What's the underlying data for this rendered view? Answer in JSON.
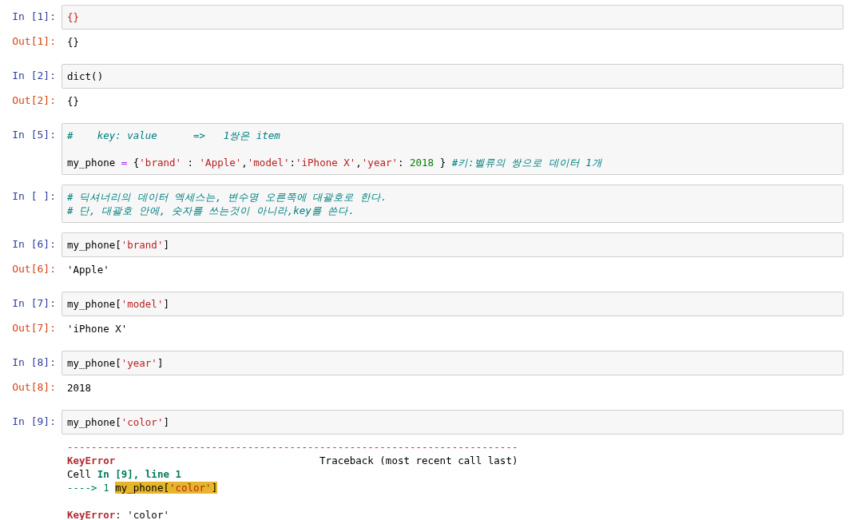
{
  "cells": [
    {
      "prompt": "In [1]:",
      "code": [
        {
          "tokens": [
            {
              "kind": "str",
              "text": "{}"
            }
          ]
        }
      ],
      "out_prompt": "Out[1]:",
      "output": [
        {
          "tokens": [
            {
              "kind": "plain",
              "text": "{}"
            }
          ]
        }
      ]
    },
    {
      "prompt": "In [2]:",
      "code": [
        {
          "tokens": [
            {
              "kind": "plain",
              "text": "dict()"
            }
          ]
        }
      ],
      "out_prompt": "Out[2]:",
      "output": [
        {
          "tokens": [
            {
              "kind": "plain",
              "text": "{}"
            }
          ]
        }
      ]
    },
    {
      "prompt": "In [5]:",
      "code": [
        {
          "tokens": [
            {
              "kind": "comment",
              "text": "#    key: value      =>   1쌍은 item"
            }
          ]
        },
        {
          "blank_before": true,
          "tokens": [
            {
              "kind": "plain",
              "text": "my_phone "
            },
            {
              "kind": "op",
              "text": "="
            },
            {
              "kind": "plain",
              "text": " {"
            },
            {
              "kind": "str",
              "text": "'brand'"
            },
            {
              "kind": "plain",
              "text": " : "
            },
            {
              "kind": "str",
              "text": "'Apple'"
            },
            {
              "kind": "plain",
              "text": ","
            },
            {
              "kind": "str",
              "text": "'model'"
            },
            {
              "kind": "plain",
              "text": ":"
            },
            {
              "kind": "str",
              "text": "'iPhone X'"
            },
            {
              "kind": "plain",
              "text": ","
            },
            {
              "kind": "str",
              "text": "'year'"
            },
            {
              "kind": "plain",
              "text": ": "
            },
            {
              "kind": "num",
              "text": "2018"
            },
            {
              "kind": "plain",
              "text": " } "
            },
            {
              "kind": "comment",
              "text": "#키:벨류의 쌍으로 데이터 1개"
            }
          ]
        }
      ]
    },
    {
      "prompt": "In [ ]:",
      "code": [
        {
          "tokens": [
            {
              "kind": "comment",
              "text": "# 딕셔너리의 데이터 엑세스는, 변수명 오른쪽에 대괄호로 한다."
            }
          ]
        },
        {
          "tokens": [
            {
              "kind": "comment",
              "text": "# 단, 대괄호 안에, 숫자를 쓰는것이 아니라,key를 쓴다."
            }
          ]
        }
      ]
    },
    {
      "prompt": "In [6]:",
      "code": [
        {
          "tokens": [
            {
              "kind": "plain",
              "text": "my_phone["
            },
            {
              "kind": "str",
              "text": "'brand'"
            },
            {
              "kind": "plain",
              "text": "]"
            }
          ]
        }
      ],
      "out_prompt": "Out[6]:",
      "output": [
        {
          "tokens": [
            {
              "kind": "plain",
              "text": "'Apple'"
            }
          ]
        }
      ]
    },
    {
      "prompt": "In [7]:",
      "code": [
        {
          "tokens": [
            {
              "kind": "plain",
              "text": "my_phone["
            },
            {
              "kind": "str",
              "text": "'model'"
            },
            {
              "kind": "plain",
              "text": "]"
            }
          ]
        }
      ],
      "out_prompt": "Out[7]:",
      "output": [
        {
          "tokens": [
            {
              "kind": "plain",
              "text": "'iPhone X'"
            }
          ]
        }
      ]
    },
    {
      "prompt": "In [8]:",
      "code": [
        {
          "tokens": [
            {
              "kind": "plain",
              "text": "my_phone["
            },
            {
              "kind": "str",
              "text": "'year'"
            },
            {
              "kind": "plain",
              "text": "]"
            }
          ]
        }
      ],
      "out_prompt": "Out[8]:",
      "output": [
        {
          "tokens": [
            {
              "kind": "plain",
              "text": "2018"
            }
          ]
        }
      ]
    },
    {
      "prompt": "In [9]:",
      "code": [
        {
          "tokens": [
            {
              "kind": "plain",
              "text": "my_phone["
            },
            {
              "kind": "str",
              "text": "'color'"
            },
            {
              "kind": "plain",
              "text": "]"
            }
          ]
        }
      ],
      "error": [
        {
          "tokens": [
            {
              "kind": "rule",
              "text": "---------------------------------------------------------------------------"
            }
          ]
        },
        {
          "tokens": [
            {
              "kind": "err",
              "text": "KeyError"
            },
            {
              "kind": "plain",
              "text": "                                  Traceback (most recent call last)"
            }
          ]
        },
        {
          "tokens": [
            {
              "kind": "plain",
              "text": "Cell "
            },
            {
              "kind": "green",
              "text": "In [9], line 1"
            }
          ]
        },
        {
          "tokens": [
            {
              "kind": "arrow",
              "text": "----> 1 "
            },
            {
              "kind": "hl",
              "text": "my_phone["
            },
            {
              "kind": "hl-str",
              "text": "'color'"
            },
            {
              "kind": "hl",
              "text": "]"
            }
          ]
        },
        {
          "blank_before": true,
          "tokens": [
            {
              "kind": "err",
              "text": "KeyError"
            },
            {
              "kind": "plain",
              "text": ": 'color'"
            }
          ]
        }
      ]
    }
  ]
}
